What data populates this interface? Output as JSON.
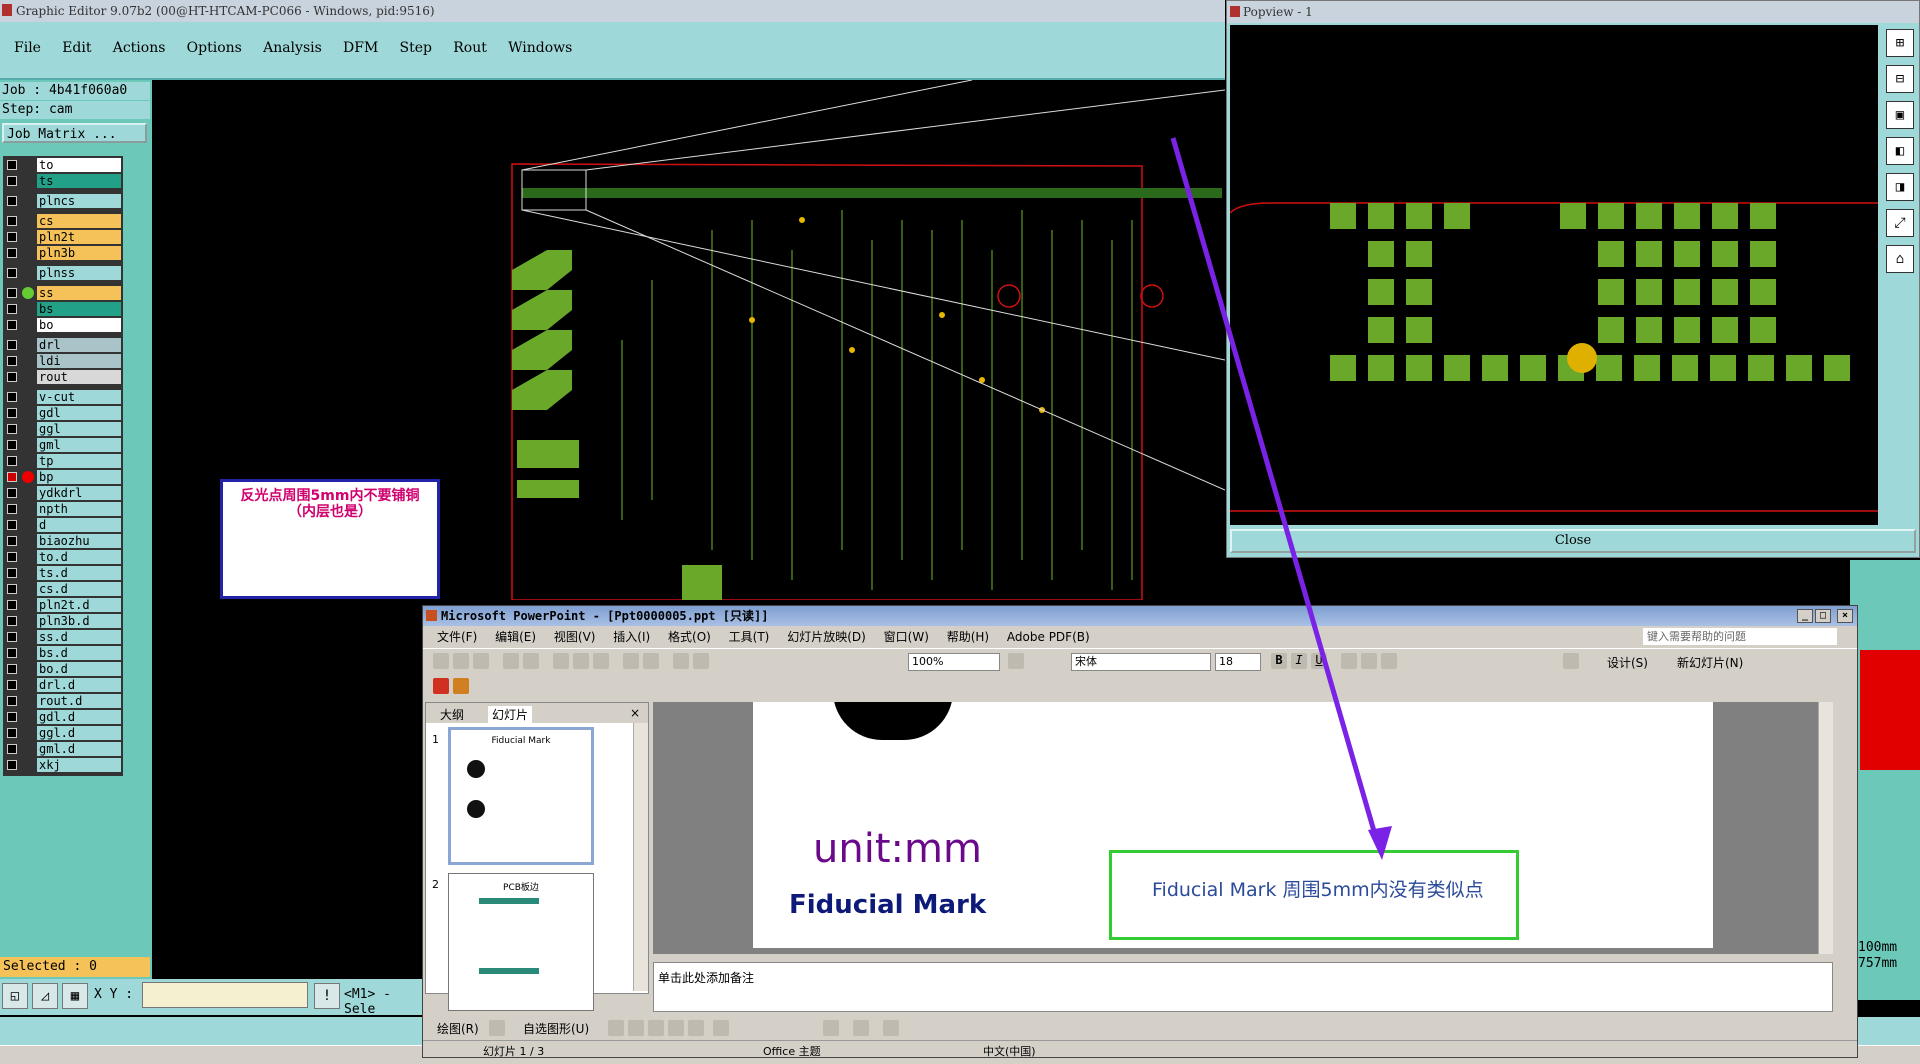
{
  "editor": {
    "title": "Graphic Editor 9.07b2 (00@HT-HTCAM-PC066 - Windows, pid:9516)",
    "menu": [
      "File",
      "Edit",
      "Actions",
      "Options",
      "Analysis",
      "DFM",
      "Step",
      "Rout",
      "Windows"
    ],
    "job": "Job : 4b41f060a0",
    "step": "Step: cam",
    "job_matrix": "Job Matrix ...",
    "layers": [
      {
        "name": "to",
        "color": "#ffffff",
        "gap": false,
        "dot": "",
        "checked": false
      },
      {
        "name": "ts",
        "color": "#22a088",
        "gap": false,
        "dot": "",
        "checked": false
      },
      {
        "name": "plncs",
        "color": "#9ed8d8",
        "gap": true,
        "dot": "",
        "checked": false
      },
      {
        "name": "cs",
        "color": "#f4c258",
        "gap": true,
        "dot": "",
        "checked": false
      },
      {
        "name": "pln2t",
        "color": "#f4c258",
        "gap": false,
        "dot": "",
        "checked": false
      },
      {
        "name": "pln3b",
        "color": "#f4c258",
        "gap": false,
        "dot": "",
        "checked": false
      },
      {
        "name": "plnss",
        "color": "#9ed8d8",
        "gap": true,
        "dot": "",
        "checked": false
      },
      {
        "name": "ss",
        "color": "#f4c258",
        "gap": true,
        "dot": "#6c3",
        "checked": false
      },
      {
        "name": "bs",
        "color": "#22a088",
        "gap": false,
        "dot": "",
        "checked": false
      },
      {
        "name": "bo",
        "color": "#ffffff",
        "gap": false,
        "dot": "",
        "checked": false
      },
      {
        "name": "drl",
        "color": "#a9c4c8",
        "gap": true,
        "dot": "",
        "checked": false
      },
      {
        "name": "ldi",
        "color": "#a9c4c8",
        "gap": false,
        "dot": "",
        "checked": false
      },
      {
        "name": "rout",
        "color": "#d8d8d8",
        "gap": false,
        "dot": "",
        "checked": false
      },
      {
        "name": "v-cut",
        "color": "#9ed8d8",
        "gap": true,
        "dot": "",
        "checked": false
      },
      {
        "name": "gdl",
        "color": "#9ed8d8",
        "gap": false,
        "dot": "",
        "checked": false
      },
      {
        "name": "ggl",
        "color": "#9ed8d8",
        "gap": false,
        "dot": "",
        "checked": false
      },
      {
        "name": "gml",
        "color": "#9ed8d8",
        "gap": false,
        "dot": "",
        "checked": false
      },
      {
        "name": "tp",
        "color": "#9ed8d8",
        "gap": false,
        "dot": "",
        "checked": false
      },
      {
        "name": "bp",
        "color": "#9ed8d8",
        "gap": false,
        "dot": "#e00",
        "checked": true
      },
      {
        "name": "ydkdrl",
        "color": "#9ed8d8",
        "gap": false,
        "dot": "",
        "checked": false
      },
      {
        "name": "npth",
        "color": "#9ed8d8",
        "gap": false,
        "dot": "",
        "checked": false
      },
      {
        "name": "d",
        "color": "#9ed8d8",
        "gap": false,
        "dot": "",
        "checked": false
      },
      {
        "name": "biaozhu",
        "color": "#9ed8d8",
        "gap": false,
        "dot": "",
        "checked": false
      },
      {
        "name": "to.d",
        "color": "#9ed8d8",
        "gap": false,
        "dot": "",
        "checked": false
      },
      {
        "name": "ts.d",
        "color": "#9ed8d8",
        "gap": false,
        "dot": "",
        "checked": false
      },
      {
        "name": "cs.d",
        "color": "#9ed8d8",
        "gap": false,
        "dot": "",
        "checked": false
      },
      {
        "name": "pln2t.d",
        "color": "#9ed8d8",
        "gap": false,
        "dot": "",
        "checked": false
      },
      {
        "name": "pln3b.d",
        "color": "#9ed8d8",
        "gap": false,
        "dot": "",
        "checked": false
      },
      {
        "name": "ss.d",
        "color": "#9ed8d8",
        "gap": false,
        "dot": "",
        "checked": false
      },
      {
        "name": "bs.d",
        "color": "#9ed8d8",
        "gap": false,
        "dot": "",
        "checked": false
      },
      {
        "name": "bo.d",
        "color": "#9ed8d8",
        "gap": false,
        "dot": "",
        "checked": false
      },
      {
        "name": "drl.d",
        "color": "#9ed8d8",
        "gap": false,
        "dot": "",
        "checked": false
      },
      {
        "name": "rout.d",
        "color": "#9ed8d8",
        "gap": false,
        "dot": "",
        "checked": false
      },
      {
        "name": "gdl.d",
        "color": "#9ed8d8",
        "gap": false,
        "dot": "",
        "checked": false
      },
      {
        "name": "ggl.d",
        "color": "#9ed8d8",
        "gap": false,
        "dot": "",
        "checked": false
      },
      {
        "name": "gml.d",
        "color": "#9ed8d8",
        "gap": false,
        "dot": "",
        "checked": false
      },
      {
        "name": "xkj",
        "color": "#9ed8d8",
        "gap": false,
        "dot": "",
        "checked": false
      }
    ],
    "selected": "Selected : 0",
    "xy_label": "X Y :",
    "mode": "<M1> - Sele",
    "note": "反光点周围5mm内不要铺铜\n（内层也是）",
    "side_units": [
      "100mm",
      "757mm"
    ]
  },
  "popview": {
    "title": "Popview - 1",
    "close_label": "Close",
    "tool_icons": [
      "zoom-in-icon",
      "zoom-out-icon",
      "pan-up-icon",
      "pan-left-icon",
      "pan-right-icon",
      "fit-icon",
      "home-icon"
    ]
  },
  "ppt": {
    "title": "Microsoft PowerPoint - [Ppt0000005.ppt [只读]]",
    "menu": [
      "文件(F)",
      "编辑(E)",
      "视图(V)",
      "插入(I)",
      "格式(O)",
      "工具(T)",
      "幻灯片放映(D)",
      "窗口(W)",
      "帮助(H)",
      "Adobe PDF(B)"
    ],
    "help_placeholder": "键入需要帮助的问题",
    "zoom": "100%",
    "font": "宋体",
    "font_size": "18",
    "design_label": "设计(S)",
    "new_slide_label": "新幻灯片(N)",
    "tabs": [
      "大纲",
      "幻灯片"
    ],
    "thumb1_title": "Fiducial Mark",
    "thumb2_title": "PCB板边",
    "slide_unit": "unit:mm",
    "slide_title": "Fiducial Mark",
    "slide_note": "Fiducial Mark 周围5mm内没有类似点",
    "notes_placeholder": "单击此处添加备注",
    "drawbar_draw": "绘图(R)",
    "drawbar_autoshape": "自选图形(U)",
    "status_slide": "幻灯片 1 / 3",
    "status_theme": "Office 主题",
    "status_lang": "中文(中国)"
  },
  "colors": {
    "teal": "#9ed8d8",
    "pcb_green": "#6aa82a",
    "arrow": "#7a22e6",
    "red_outline": "#d01010"
  }
}
